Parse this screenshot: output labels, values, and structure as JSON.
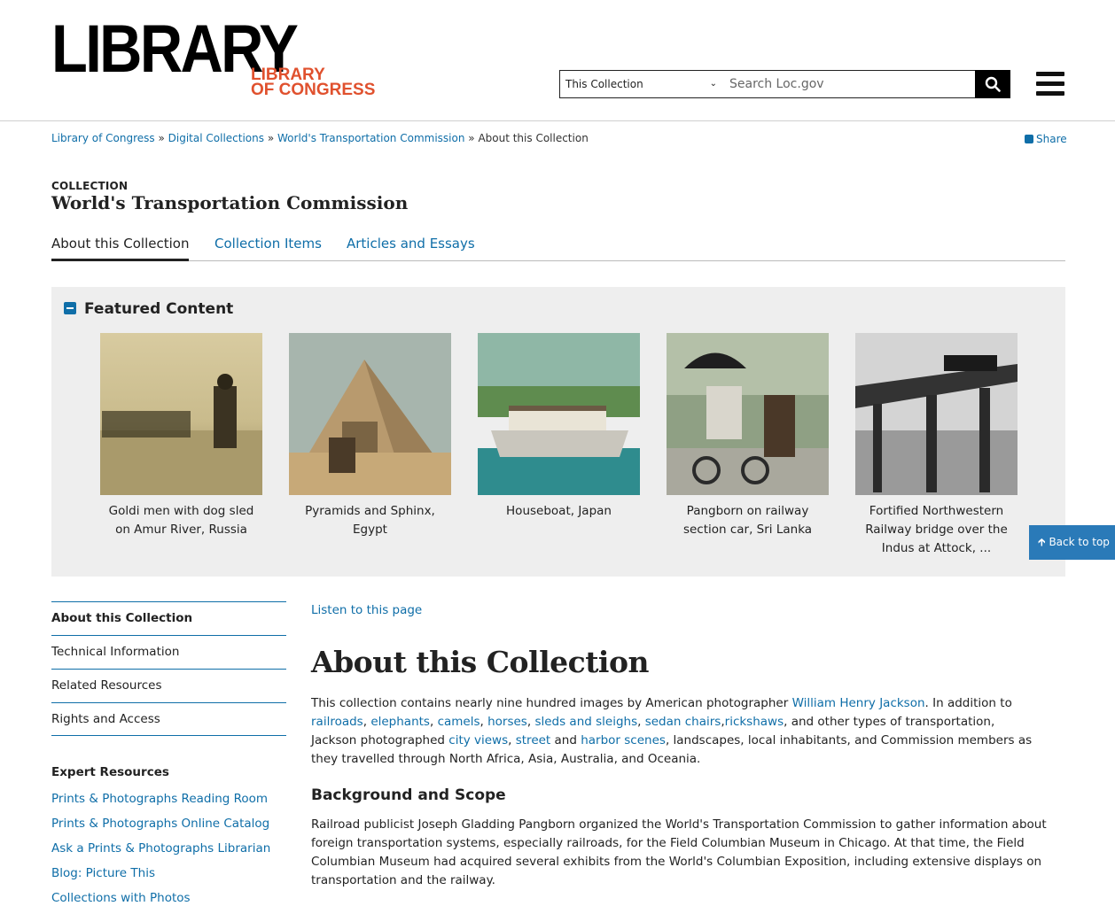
{
  "header": {
    "logo_main": "LIBRARY",
    "logo_sub_line1": "LIBRARY",
    "logo_sub_line2": "OF CONGRESS",
    "search_scope": "This Collection",
    "search_placeholder": "Search Loc.gov"
  },
  "breadcrumb": {
    "items": [
      "Library of Congress",
      "Digital Collections",
      "World's Transportation Commission"
    ],
    "separator": "»",
    "current": "About this Collection"
  },
  "share_label": "Share",
  "collection": {
    "kicker": "COLLECTION",
    "title": "World's Transportation Commission"
  },
  "tabs": [
    "About this Collection",
    "Collection Items",
    "Articles and Essays"
  ],
  "featured": {
    "heading": "Featured Content",
    "items": [
      {
        "caption": "Goldi men with dog sled on Amur River, Russia"
      },
      {
        "caption": "Pyramids and Sphinx, Egypt"
      },
      {
        "caption": "Houseboat, Japan"
      },
      {
        "caption": "Pangborn on railway section car, Sri Lanka"
      },
      {
        "caption": "Fortified Northwestern Railway bridge over the Indus at Attock, ..."
      }
    ]
  },
  "back_to_top": "Back to top",
  "sidebar": {
    "items": [
      "About this Collection",
      "Technical Information",
      "Related Resources",
      "Rights and Access"
    ],
    "expert_heading": "Expert Resources",
    "expert_links": [
      "Prints & Photographs Reading Room",
      "Prints & Photographs Online Catalog",
      "Ask a Prints & Photographs Librarian",
      "Blog: Picture This",
      "Collections with Photos"
    ]
  },
  "main": {
    "listen": "Listen to this page",
    "heading": "About this Collection",
    "intro": {
      "t1": "This collection contains nearly nine hundred images by American photographer ",
      "l_jackson": "William Henry Jackson",
      "t2": ". In addition to ",
      "l_railroads": "railroads",
      "l_elephants": "elephants",
      "l_camels": "camels",
      "l_horses": "horses",
      "l_sleds": "sleds and sleighs",
      "l_sedan": "sedan chairs",
      "l_rickshaws": "rickshaws",
      "t3": ", and other types of transportation, Jackson photographed ",
      "l_city": "city views",
      "l_street": "street",
      "t4": " and ",
      "l_harbor": "harbor scenes",
      "t5": ", landscapes, local inhabitants, and Commission members as they travelled through North Africa, Asia, Australia, and Oceania."
    },
    "subheading": "Background and Scope",
    "background": "Railroad publicist Joseph Gladding Pangborn organized the World's Transportation Commission to gather information about foreign transportation systems, especially railroads, for the Field Columbian Museum in Chicago. At that time, the Field Columbian Museum had acquired several exhibits from the World's Columbian Exposition, including extensive displays on transportation and the railway."
  },
  "colors": {
    "link": "#0f6ea8",
    "logo_accent": "#e0512e",
    "featured_bg": "#eeeeee",
    "back_to_top_bg": "#2a7ab8"
  }
}
